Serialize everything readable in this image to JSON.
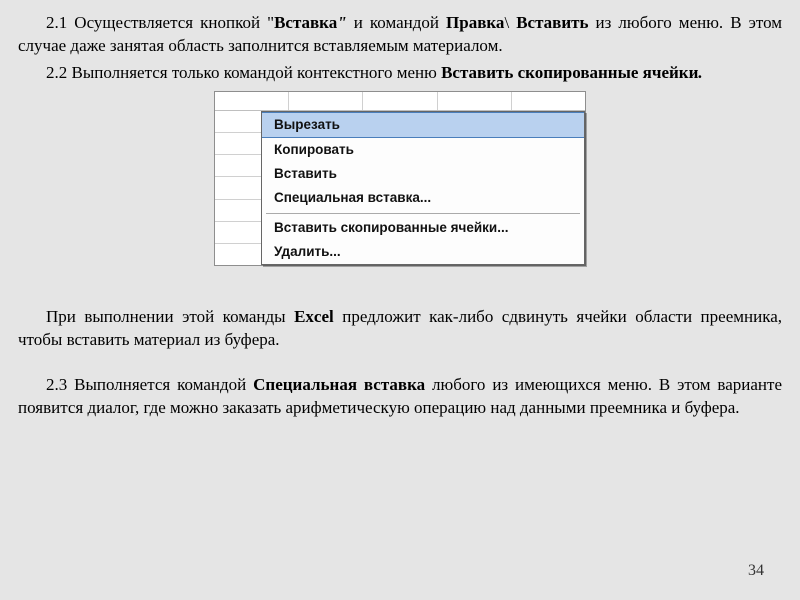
{
  "para1": {
    "lead": "2.1 Осуществляется кнопкой \"",
    "btn": "Вставка",
    "quote2": "\"",
    "mid1": " и командой ",
    "cmd1": "Правка",
    "slash": "\\",
    "cmd2": " Вставить",
    "tail": " из любого меню. В этом случае даже занятая область заполнится вставляемым материалом."
  },
  "para2": {
    "lead": "2.2 Выполняется только командой контекстного меню ",
    "cmd": "Вставить скопированные ячейки",
    "dot": "."
  },
  "menu": {
    "items": [
      "Вырезать",
      "Копировать",
      "Вставить",
      "Специальная вставка...",
      "Вставить скопированные ячейки...",
      "Удалить..."
    ]
  },
  "para3": {
    "lead": "При выполнении этой команды ",
    "excel": "Excel",
    "tail": " предложит как-либо сдвинуть ячейки области преемника, чтобы вставить материал из буфера."
  },
  "para4": {
    "lead": "2.3 Выполняется командой ",
    "cmd": "Специальная вставка",
    "tail": " любого из имеющихся меню. В этом варианте появится диалог, где можно заказать арифметическую операцию  над  данными преемника и буфера."
  },
  "page_number": "34"
}
